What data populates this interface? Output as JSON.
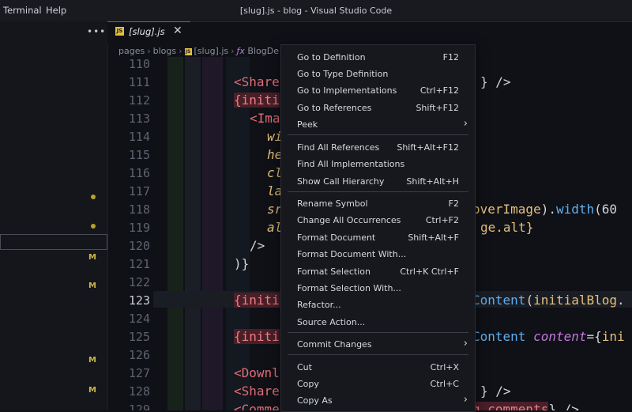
{
  "menubar": {
    "terminal": "Terminal",
    "help": "Help"
  },
  "window_title": "[slug].js - blog - Visual Studio Code",
  "sidebar": {
    "more_actions": "•••",
    "badge_m": "M"
  },
  "tab": {
    "name": "[slug].js",
    "js_label": "JS",
    "close": "✕"
  },
  "breadcrumb": {
    "parts": [
      "pages",
      "blogs",
      "[slug].js",
      "BlogDe"
    ],
    "fx": "ƒx",
    "sep": "›"
  },
  "editor": {
    "line_numbers": [
      "110",
      "111",
      "112",
      "113",
      "114",
      "115",
      "116",
      "117",
      "118",
      "119",
      "120",
      "121",
      "122",
      "123",
      "124",
      "125",
      "126",
      "127",
      "128",
      "129"
    ],
    "current_line": "123"
  },
  "code": {
    "l111_a": "<Share",
    "l111_b": "} />",
    "l112_a": "{initi",
    "l113_a": "<Ima",
    "l114_a": "wi",
    "l115_a": "he",
    "l116_a": "cl",
    "l117_a": "la",
    "l118_a": "sr",
    "l118_b": "overImage",
    "l118_c": ").",
    "l118_d": "width",
    "l118_e": "(60",
    "l119_a": "al",
    "l119_b": "ge.alt}",
    "l120_a": "/>",
    "l121_a": ")}",
    "l123_a": "{initi",
    "l123_b": "Content",
    "l123_c": "(",
    "l123_d": "initialBlog",
    "l123_e": ".",
    "l125_a": "{initi",
    "l125_b": "Content",
    "l125_c": "content",
    "l125_d": "={",
    "l125_e": "ini",
    "l127_a": "<Downl",
    "l128_a": "<Share",
    "l128_b": "} />",
    "l129_a": "<Comme",
    "l129_b": "g comments",
    "l129_c": "} />"
  },
  "context_menu": {
    "items": [
      {
        "label": "Go to Definition",
        "key": "F12"
      },
      {
        "label": "Go to Type Definition",
        "key": ""
      },
      {
        "label": "Go to Implementations",
        "key": "Ctrl+F12"
      },
      {
        "label": "Go to References",
        "key": "Shift+F12"
      },
      {
        "label": "Peek",
        "key": "",
        "submenu": "›"
      },
      {
        "label": "Find All References",
        "key": "Shift+Alt+F12"
      },
      {
        "label": "Find All Implementations",
        "key": ""
      },
      {
        "label": "Show Call Hierarchy",
        "key": "Shift+Alt+H"
      },
      {
        "label": "Rename Symbol",
        "key": "F2"
      },
      {
        "label": "Change All Occurrences",
        "key": "Ctrl+F2"
      },
      {
        "label": "Format Document",
        "key": "Shift+Alt+F"
      },
      {
        "label": "Format Document With...",
        "key": ""
      },
      {
        "label": "Format Selection",
        "key": "Ctrl+K Ctrl+F"
      },
      {
        "label": "Format Selection With...",
        "key": ""
      },
      {
        "label": "Refactor...",
        "key": ""
      },
      {
        "label": "Source Action...",
        "key": ""
      },
      {
        "label": "Commit Changes",
        "key": "",
        "submenu": "›"
      },
      {
        "label": "Cut",
        "key": "Ctrl+X"
      },
      {
        "label": "Copy",
        "key": "Ctrl+C"
      },
      {
        "label": "Copy As",
        "key": "",
        "submenu": "›"
      }
    ]
  },
  "colors": {
    "accent": "#2f6fd0",
    "js_yellow": "#e5c03c",
    "modified": "#c8b84a",
    "tag_red": "#e06c75"
  }
}
